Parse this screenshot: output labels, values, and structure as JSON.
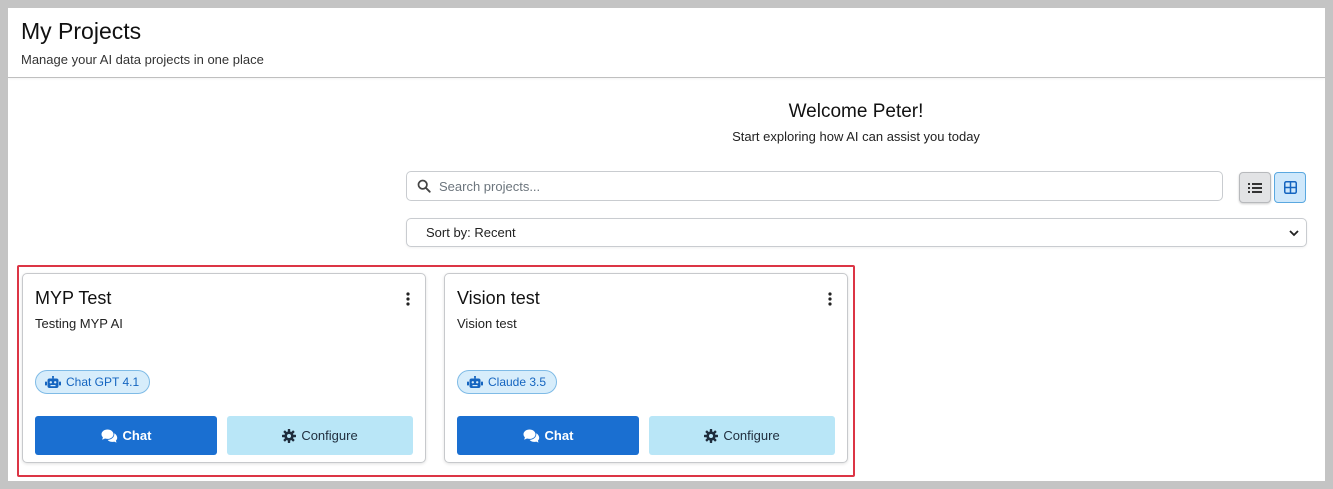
{
  "header": {
    "title": "My Projects",
    "subtitle": "Manage your AI data projects in one place"
  },
  "welcome": {
    "title": "Welcome Peter!",
    "subtitle": "Start exploring how AI can assist you today"
  },
  "search": {
    "placeholder": "Search projects...",
    "value": ""
  },
  "view_toggle": {
    "active": "grid",
    "icons": [
      "list-icon",
      "grid-icon"
    ]
  },
  "sort": {
    "label": "Sort by: Recent"
  },
  "projects": [
    {
      "name": "MYP Test",
      "description": "Testing MYP AI",
      "model": "Chat GPT 4.1",
      "chat_label": "Chat",
      "configure_label": "Configure"
    },
    {
      "name": "Vision test",
      "description": "Vision test",
      "model": "Claude 3.5",
      "chat_label": "Chat",
      "configure_label": "Configure"
    }
  ],
  "colors": {
    "primary": "#1a6fd1",
    "secondary": "#b9e6f7",
    "badge_bg": "#d7edfb",
    "highlight": "#dc3545"
  }
}
